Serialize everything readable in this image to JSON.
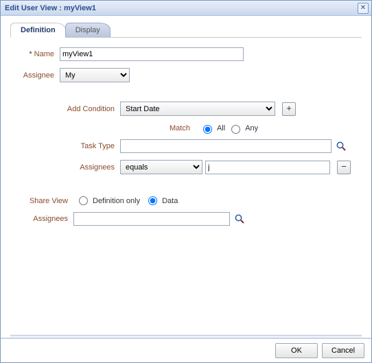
{
  "header": {
    "title": "Edit User View : myView1"
  },
  "tabs": {
    "definition": "Definition",
    "display": "Display"
  },
  "form": {
    "name_label": "Name",
    "name_value": "myView1",
    "assignee_label": "Assignee",
    "assignee_value": "My",
    "add_condition_label": "Add Condition",
    "add_condition_value": "Start Date",
    "match_label": "Match",
    "match_all": "All",
    "match_any": "Any",
    "task_type_label": "Task Type",
    "task_type_value": "",
    "assignees_label": "Assignees",
    "assignees_op": "equals",
    "assignees_value": "j",
    "share_view_label": "Share View",
    "share_def_only": "Definition only",
    "share_data": "Data",
    "share_assignees_label": "Assignees",
    "share_assignees_value": ""
  },
  "footer": {
    "ok": "OK",
    "cancel": "Cancel"
  }
}
